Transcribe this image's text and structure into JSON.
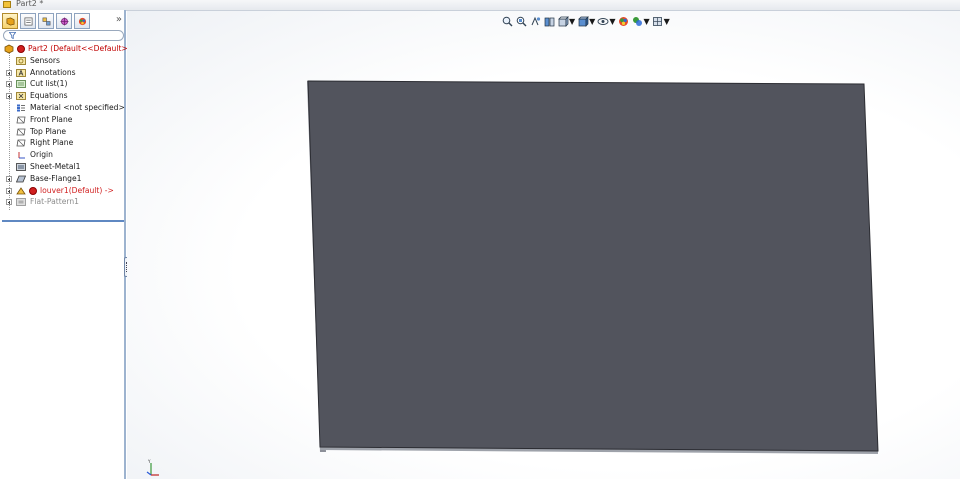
{
  "window": {
    "title": "Part2 *"
  },
  "feature_tree": {
    "root": {
      "label": "Part2  (Default<<Default>_D"
    },
    "items": [
      {
        "label": "Sensors",
        "icon": "sensor-icon",
        "expandable": false,
        "style": "normal"
      },
      {
        "label": "Annotations",
        "icon": "annotations-icon",
        "expandable": true,
        "style": "normal"
      },
      {
        "label": "Cut list(1)",
        "icon": "cut-list-icon",
        "expandable": true,
        "style": "normal"
      },
      {
        "label": "Equations",
        "icon": "equations-icon",
        "expandable": true,
        "style": "normal"
      },
      {
        "label": "Material <not specified>",
        "icon": "material-icon",
        "expandable": false,
        "style": "normal"
      },
      {
        "label": "Front Plane",
        "icon": "plane-icon",
        "expandable": false,
        "style": "normal"
      },
      {
        "label": "Top Plane",
        "icon": "plane-icon",
        "expandable": false,
        "style": "normal"
      },
      {
        "label": "Right Plane",
        "icon": "plane-icon",
        "expandable": false,
        "style": "normal"
      },
      {
        "label": "Origin",
        "icon": "origin-icon",
        "expandable": false,
        "style": "normal"
      },
      {
        "label": "Sheet-Metal1",
        "icon": "sheet-metal-icon",
        "expandable": false,
        "style": "normal"
      },
      {
        "label": "Base-Flange1",
        "icon": "base-flange-icon",
        "expandable": true,
        "style": "normal"
      },
      {
        "label": "louver1(Default) ->",
        "icon": "louver-icon",
        "expandable": true,
        "style": "error"
      },
      {
        "label": "Flat-Pattern1",
        "icon": "flat-pattern-icon",
        "expandable": true,
        "style": "suppressed"
      }
    ]
  },
  "colors": {
    "part_face": "#52545d",
    "part_edge_light": "#8c8f98",
    "error_text": "#c00000",
    "panel_border": "#9db3cf"
  }
}
